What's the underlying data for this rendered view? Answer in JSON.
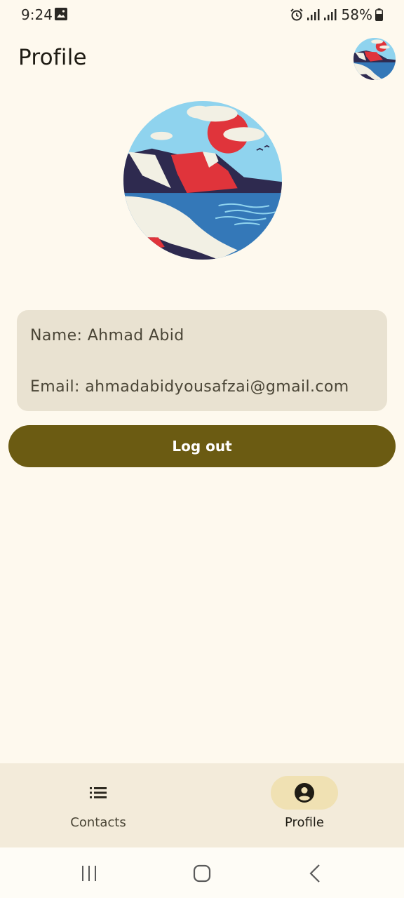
{
  "status_bar": {
    "time": "9:24",
    "gallery_icon": "image-icon",
    "alarm_icon": "alarm-icon",
    "signal_icons": [
      "signal-icon",
      "signal-icon"
    ],
    "battery_text": "58%",
    "battery_level": 0.58
  },
  "app_bar": {
    "title": "Profile",
    "avatar_icon": "avatar"
  },
  "profile": {
    "name_line": "Name: Ahmad Abid",
    "email_line": "Email: ahmadabidyousafzai@gmail.com"
  },
  "actions": {
    "logout_label": "Log out"
  },
  "bottom_nav": {
    "items": [
      {
        "label": "Contacts",
        "icon": "list-icon",
        "selected": false
      },
      {
        "label": "Profile",
        "icon": "account-circle-icon",
        "selected": true
      }
    ]
  },
  "system_nav": {
    "buttons": [
      "recents-icon",
      "home-icon",
      "back-icon"
    ]
  },
  "colors": {
    "background": "#fef9ee",
    "card": "#e9e2d1",
    "primary_button": "#6b5b12",
    "nav_indicator": "#f0e1b3",
    "nav_background": "#f3ebda"
  }
}
